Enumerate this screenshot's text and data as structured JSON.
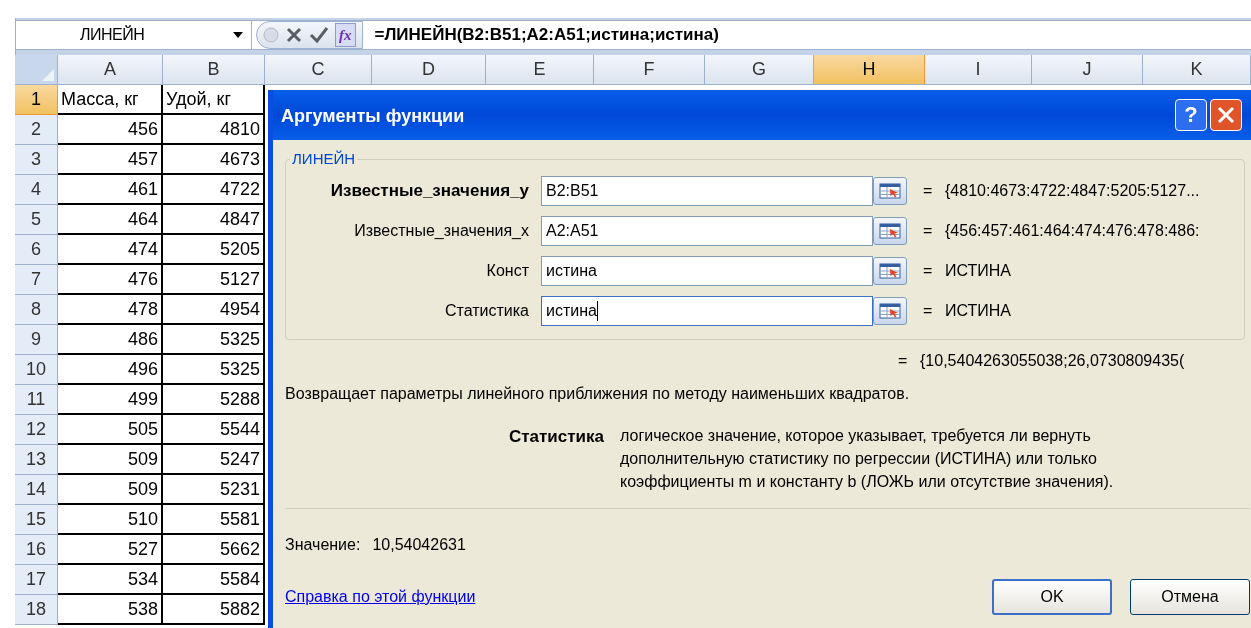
{
  "name_box": "ЛИНЕЙН",
  "function_button": "fx",
  "formula": "=ЛИНЕЙН(B2:B51;A2:A51;истина;истина)",
  "columns": [
    {
      "label": "A",
      "selected": false
    },
    {
      "label": "B",
      "selected": false
    },
    {
      "label": "C",
      "selected": false
    },
    {
      "label": "D",
      "selected": false
    },
    {
      "label": "E",
      "selected": false
    },
    {
      "label": "F",
      "selected": false
    },
    {
      "label": "G",
      "selected": false
    },
    {
      "label": "H",
      "selected": true
    },
    {
      "label": "I",
      "selected": false
    },
    {
      "label": "J",
      "selected": false
    },
    {
      "label": "K",
      "selected": false
    }
  ],
  "rows": [
    {
      "number": "1",
      "selected": true,
      "cells": [
        "Масса, кг",
        "Удой, кг"
      ]
    },
    {
      "number": "2",
      "selected": false,
      "cells": [
        "456",
        "4810"
      ]
    },
    {
      "number": "3",
      "selected": false,
      "cells": [
        "457",
        "4673"
      ]
    },
    {
      "number": "4",
      "selected": false,
      "cells": [
        "461",
        "4722"
      ]
    },
    {
      "number": "5",
      "selected": false,
      "cells": [
        "464",
        "4847"
      ]
    },
    {
      "number": "6",
      "selected": false,
      "cells": [
        "474",
        "5205"
      ]
    },
    {
      "number": "7",
      "selected": false,
      "cells": [
        "476",
        "5127"
      ]
    },
    {
      "number": "8",
      "selected": false,
      "cells": [
        "478",
        "4954"
      ]
    },
    {
      "number": "9",
      "selected": false,
      "cells": [
        "486",
        "5325"
      ]
    },
    {
      "number": "10",
      "selected": false,
      "cells": [
        "496",
        "5325"
      ]
    },
    {
      "number": "11",
      "selected": false,
      "cells": [
        "499",
        "5288"
      ]
    },
    {
      "number": "12",
      "selected": false,
      "cells": [
        "505",
        "5544"
      ]
    },
    {
      "number": "13",
      "selected": false,
      "cells": [
        "509",
        "5247"
      ]
    },
    {
      "number": "14",
      "selected": false,
      "cells": [
        "509",
        "5231"
      ]
    },
    {
      "number": "15",
      "selected": false,
      "cells": [
        "510",
        "5581"
      ]
    },
    {
      "number": "16",
      "selected": false,
      "cells": [
        "527",
        "5662"
      ]
    },
    {
      "number": "17",
      "selected": false,
      "cells": [
        "534",
        "5584"
      ]
    },
    {
      "number": "18",
      "selected": false,
      "cells": [
        "538",
        "5882"
      ]
    }
  ],
  "dialog": {
    "title": "Аргументы функции",
    "help_button": "?",
    "group_label": "ЛИНЕЙН",
    "arguments": [
      {
        "label": "Известные_значения_y",
        "bold": true,
        "value": "B2:B51",
        "focused": false,
        "equals": "=",
        "result": "{4810:4673:4722:4847:5205:5127..."
      },
      {
        "label": "Известные_значения_x",
        "bold": false,
        "value": "A2:A51",
        "focused": false,
        "equals": "=",
        "result": "{456:457:461:464:474:476:478:486:"
      },
      {
        "label": "Конст",
        "bold": false,
        "value": "истина",
        "focused": false,
        "equals": "=",
        "result": "ИСТИНА"
      },
      {
        "label": "Статистика",
        "bold": false,
        "value": "истина",
        "focused": true,
        "equals": "=",
        "result": "ИСТИНА"
      }
    ],
    "formula_equals": "=",
    "formula_result": "{10,5404263055038;26,0730809435(",
    "description": "Возвращает параметры линейного приближения по методу наименьших квадратов.",
    "param_name": "Статистика",
    "param_description": [
      "логическое значение, которое указывает, требуется ли вернуть",
      "дополнительную статистику по регрессии (ИСТИНА) или только",
      "коэффициенты m и константу b (ЛОЖЬ или отсутствие значения)."
    ],
    "value_label": "Значение:",
    "value": "10,54042631",
    "help_link": "Справка по этой функции",
    "buttons": [
      {
        "label": "OK",
        "default": true
      },
      {
        "label": "Отмена",
        "default": false
      }
    ]
  }
}
